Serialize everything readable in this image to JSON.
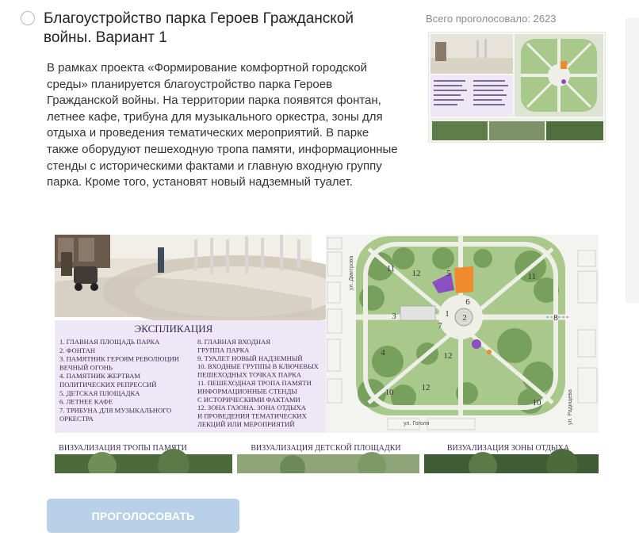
{
  "project": {
    "title": "Благоустройство парка Героев Гражданской войны. Вариант 1",
    "description": "В рамках проекта «Формирование комфортной городской среды» планируется благоустройство парка Героев Гражданской войны. На территории парка появятся фонтан, летнее кафе, трибуна для музыкального оркестра, зоны для отдыха и проведения тематических мероприятий. В парке также оборудуют пешеходную тропа памяти, информационные стенды с историческими фактами и главную входную группу парка. Кроме того, установят новый надземный туалет.",
    "votes_label": "Всего проголосовало: 2623"
  },
  "poster": {
    "legend_title": "ЭКСПЛИКАЦИЯ",
    "legend_left": [
      "1. ГЛАВНАЯ ПЛОЩАДЬ ПАРКА",
      "2. ФОНТАН",
      "3. ПАМЯТНИК ГЕРОЯМ РЕВОЛЮЦИИ",
      "    ВЕЧНЫЙ ОГОНЬ",
      "4. ПАМЯТНИК ЖЕРТВАМ",
      "    ПОЛИТИЧЕСКИХ РЕПРЕССИЙ",
      "5. ДЕТСКАЯ ПЛОЩАДКА",
      "6. ЛЕТНЕЕ КАФЕ",
      "7. ТРИБУНА ДЛЯ МУЗЫКАЛЬНОГО",
      "    ОРКЕСТРА"
    ],
    "legend_right": [
      "8. ГЛАВНАЯ ВХОДНАЯ",
      "    ГРУППА ПАРКА",
      "9. ТУАЛЕТ НОВЫЙ НАДЗЕМНЫЙ",
      "10. ВХОДНЫЕ ГРУППЫ В КЛЮЧЕВЫХ",
      "     ПЕШЕХОДНЫХ ТОЧКАХ ПАРКА",
      "11. ПЕШЕХОДНАЯ ТРОПА ПАМЯТИ",
      "     ИНФОРМАЦИОННЫЕ СТЕНДЫ",
      "     С ИСТОРИЧЕСКИМИ ФАКТАМИ",
      "12. ЗОНА ГАЗОНА. ЗОНА ОТДЫХА",
      "     И ПРОВЕДЕНИЯ ТЕМАТИЧЕСКИХ",
      "     ЛЕКЦИЙ ИЛИ МЕРОПРИЯТИЙ"
    ],
    "visualization_labels": [
      "ВИЗУАЛИЗАЦИЯ ТРОПЫ ПАМЯТИ",
      "ВИЗУАЛИЗАЦИЯ ДЕТСКОЙ ПЛОЩАДКИ",
      "ВИЗУАЛИЗАЦИЯ ЗОНЫ ОТДЫХА"
    ],
    "street_labels": [
      "ул. Дмитрова",
      "ул. Радищева",
      "ул. Гоголя"
    ],
    "plan_markers": [
      "1",
      "2",
      "3",
      "4",
      "5",
      "6",
      "7",
      "8",
      "10",
      "10",
      "11",
      "11",
      "12",
      "12",
      "12"
    ]
  },
  "vote_button": {
    "label": "ПРОГОЛОСОВАТЬ"
  },
  "colors": {
    "button_bg": "#b8d1e8",
    "legend_bg": "#eee8f6",
    "lawn": "#a9c98c",
    "path": "#eef0e8",
    "accent_orange": "#f08a2c",
    "accent_purple": "#8a4fc0"
  }
}
